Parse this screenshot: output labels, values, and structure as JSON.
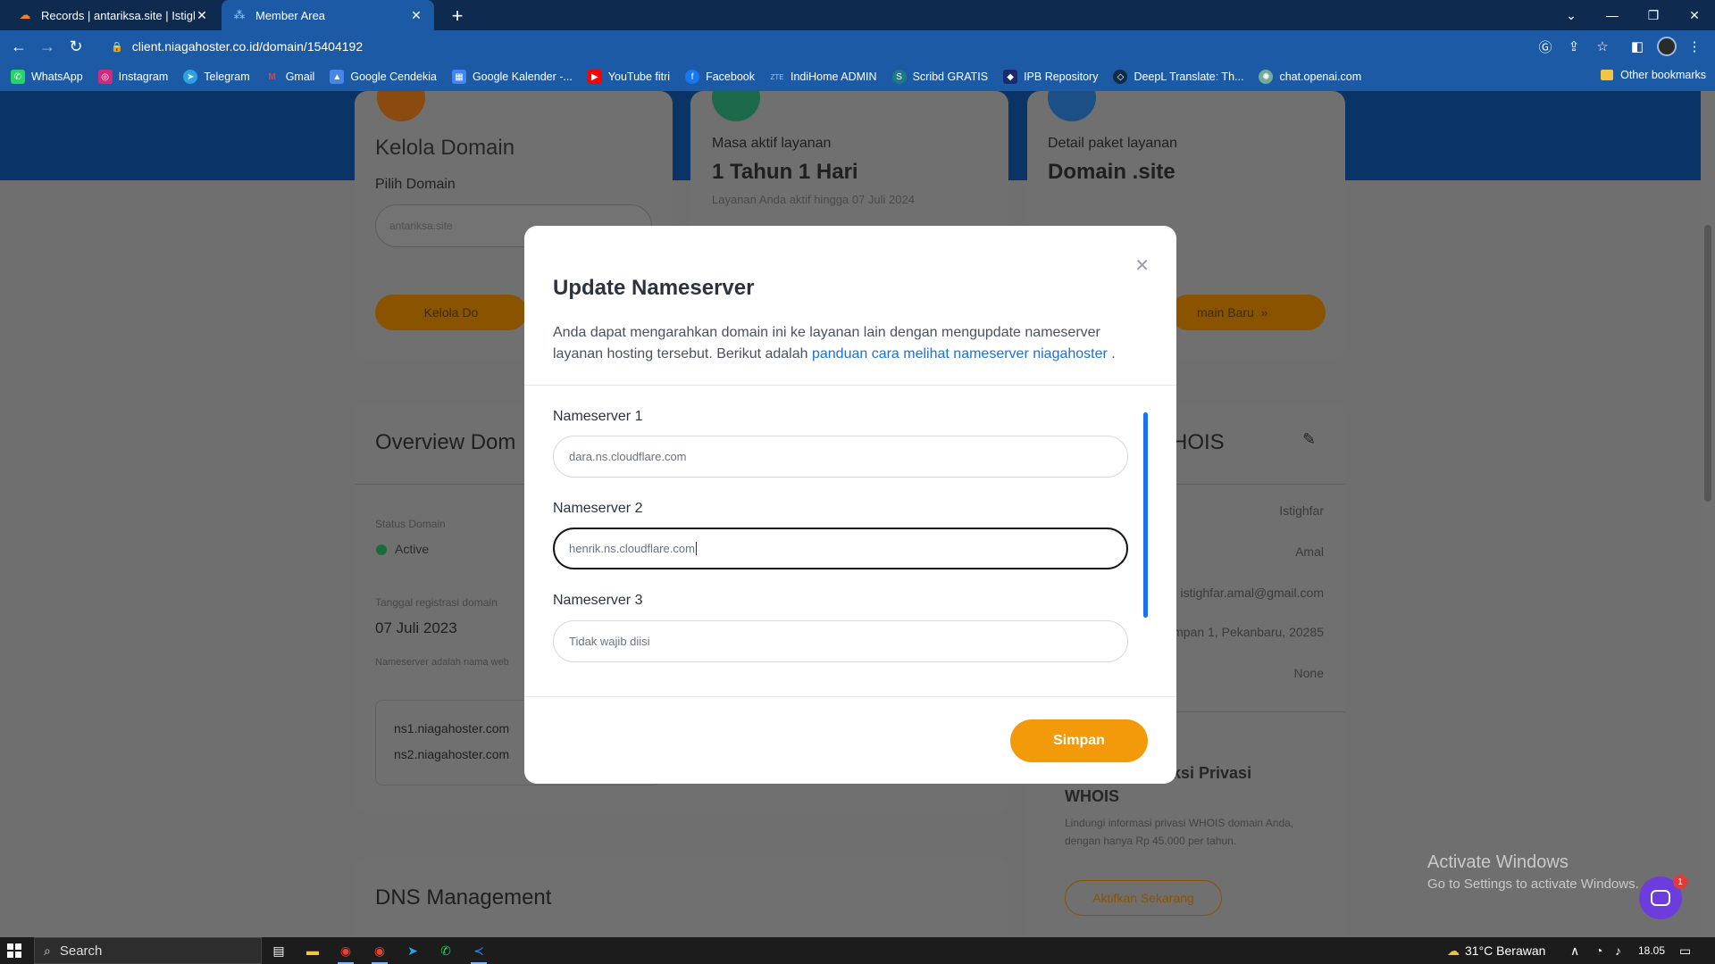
{
  "browser": {
    "tabs": [
      {
        "title": "Records | antariksa.site | Istighfar",
        "icon": "cloudflare-icon",
        "active": false
      },
      {
        "title": "Member Area",
        "icon": "niagahoster-icon",
        "active": true
      }
    ],
    "url": "client.niagahoster.co.id/domain/15404192",
    "bookmarks": [
      {
        "label": "WhatsApp",
        "icon": "whatsapp-icon",
        "color": "#25d366"
      },
      {
        "label": "Instagram",
        "icon": "instagram-icon",
        "color": "#d6287a"
      },
      {
        "label": "Telegram",
        "icon": "telegram-icon",
        "color": "#2aa3e0"
      },
      {
        "label": "Gmail",
        "icon": "gmail-icon",
        "color": "#ea4335"
      },
      {
        "label": "Google Cendekia",
        "icon": "scholar-icon",
        "color": "#4a86e8"
      },
      {
        "label": "Google Kalender -...",
        "icon": "calendar-icon",
        "color": "#4285f4"
      },
      {
        "label": "YouTube fitri",
        "icon": "youtube-icon",
        "color": "#ff0000"
      },
      {
        "label": "Facebook",
        "icon": "facebook-icon",
        "color": "#1877f2"
      },
      {
        "label": "IndiHome ADMIN",
        "icon": "zte-icon",
        "color": "#1d5aa6"
      },
      {
        "label": "Scribd GRATIS",
        "icon": "scribd-icon",
        "color": "#1e7b85"
      },
      {
        "label": "IPB Repository",
        "icon": "ipb-icon",
        "color": "#1a2a6c"
      },
      {
        "label": "DeepL Translate: Th...",
        "icon": "deepl-icon",
        "color": "#0f2b46"
      },
      {
        "label": "chat.openai.com",
        "icon": "openai-icon",
        "color": "#74aa9c"
      }
    ],
    "other_bookmarks": "Other bookmarks"
  },
  "background_page": {
    "kelola_title": "Kelola Domain",
    "pilih_label": "Pilih Domain",
    "pilih_value": "antariksa.site",
    "kelola_btn": "Kelola Do",
    "masa_label": "Masa aktif layanan",
    "masa_value": "1 Tahun 1 Hari",
    "masa_note": "Layanan Anda aktif hingga 07 Juli 2024",
    "detail_label": "Detail paket layanan",
    "detail_value": "Domain .site",
    "beli_btn": "main Baru",
    "overview_title": "Overview Dom",
    "status_label": "Status Domain",
    "status_value": "Active",
    "reg_label": "Tanggal registrasi domain",
    "reg_value": "07 Juli 2023",
    "ns_note": "Nameserver adalah nama web",
    "ns1": "ns1.niagahoster.com",
    "ns2": "ns2.niagahoster.com",
    "whois_title": "HOIS",
    "whois_name1": "Istighfar",
    "whois_name2": "Amal",
    "whois_email": "istighfar.amal@gmail.com",
    "whois_addr": "mpan 1, Pekanbaru, 20285",
    "whois_org": "None",
    "privasi_title1": "ksi Privasi",
    "privasi_title2": "WHOIS",
    "privasi_desc1": "Lindungi informasi privasi WHOIS domain Anda,",
    "privasi_desc2": "dengan hanya Rp 45.000 per tahun.",
    "privasi_btn": "Aktifkan Sekarang",
    "dns_title": "DNS Management"
  },
  "modal": {
    "title": "Update Nameserver",
    "desc_text": "Anda dapat mengarahkan domain ini ke layanan lain dengan mengupdate nameserver layanan hosting tersebut. Berikut adalah ",
    "desc_link": "panduan cara melihat nameserver niagahoster",
    "desc_end": " .",
    "fields": [
      {
        "label": "Nameserver 1",
        "value": "dara.ns.cloudflare.com"
      },
      {
        "label": "Nameserver 2",
        "value": "henrik.ns.cloudflare.com"
      },
      {
        "label": "Nameserver 3",
        "placeholder": "Tidak wajib diisi"
      }
    ],
    "save_label": "Simpan"
  },
  "windows": {
    "activate_title": "Activate Windows",
    "activate_sub": "Go to Settings to activate Windows.",
    "search": "Search",
    "weather": "31°C  Berawan",
    "time": "18.05",
    "chat_badge": "1"
  },
  "colors": {
    "accent": "#f39a0b",
    "link": "#1e70d6",
    "chrome": "#1d5aa6"
  }
}
